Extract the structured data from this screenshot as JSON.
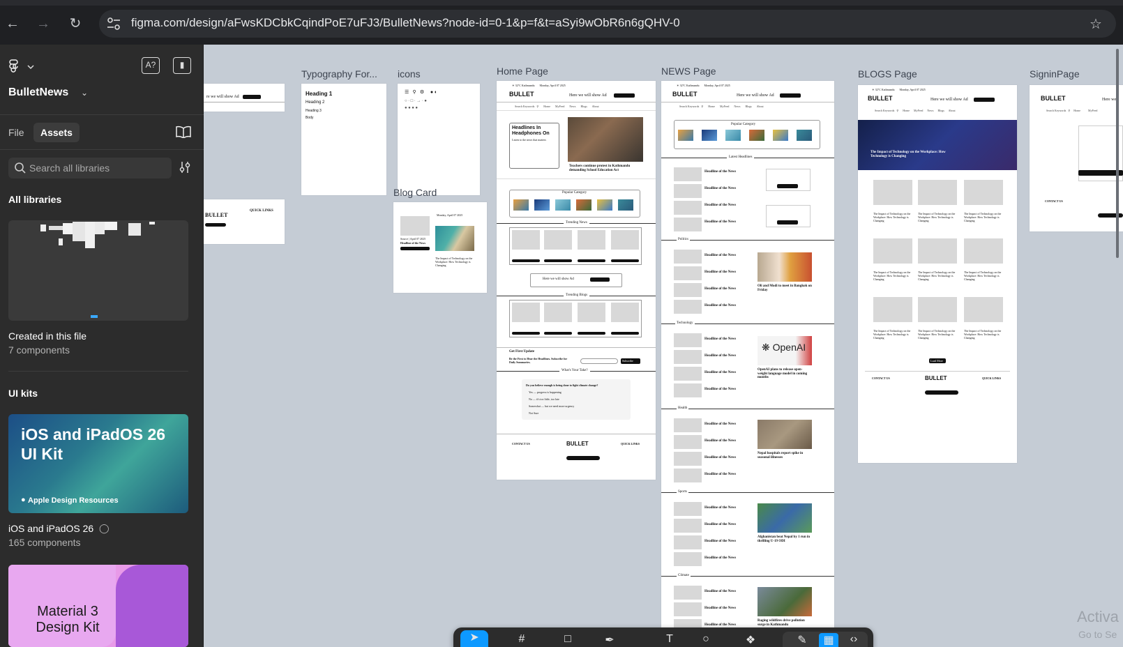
{
  "browser": {
    "url": "figma.com/design/aFwsKDCbkCqindPoE7uFJ3/BulletNews?node-id=0-1&p=f&t=aSyi9wObR6n6gQHV-0"
  },
  "panel": {
    "file_name": "BulletNews",
    "tab_file": "File",
    "tab_assets": "Assets",
    "search_placeholder": "Search all libraries",
    "all_libraries": "All libraries",
    "created_title": "Created in this file",
    "created_count": "7 components",
    "ui_kits": "UI kits",
    "ios_thumb": "iOS and iPadOS 26 UI Kit",
    "ios_badge": "Apple Design Resources",
    "ios_title": "iOS and iPadOS 26",
    "ios_count": "165 components",
    "material_thumb": "Material 3 Design Kit"
  },
  "frames": {
    "typography": "Typography For...",
    "icons": "icons",
    "blog_card": "Blog Card",
    "home": "Home Page",
    "news": "NEWS Page",
    "blogs": "BLOGS Page",
    "signin": "SigninPage"
  },
  "home": {
    "ad_text": "Here we will show Ad",
    "hero_title": "Headlines In Headphones On",
    "hero_sub": "Listen to the news that matters",
    "hero_caption": "Teachers continue protest in Kathmandu demanding School Education Act",
    "popular": "Popular Category",
    "trending_news": "Trending News",
    "trending_blogs": "Trending Blogs",
    "get_update": "Get First Update",
    "update_text": "Be the First to Hear the Headlines. Subscribe for Daily Summaries.",
    "subscribe": "Subscribe",
    "whats_take": "What's Your Take?",
    "poll_q": "Do you believe enough is being done to fight climate change?",
    "poll_opts": [
      "Yes — progress is happening",
      "No — it's too little, too late",
      "Somewhat — but we need more urgency",
      "Not Sure"
    ],
    "contact": "CONTACT US",
    "quick_links": "QUICK LINKS"
  },
  "news": {
    "popular": "Popular Category",
    "latest": "Latest Headlines",
    "sections": [
      "Politics",
      "Technology",
      "Health",
      "Sports",
      "Climate"
    ],
    "headline": "Headline of the News",
    "captions": [
      "Oli and Modi to meet in Bangkok on Friday",
      "OpenAI plans to release open-weight language model in coming months",
      "Nepal hospitals report spike in seasonal illnesses",
      "Afghanistan beat Nepal by 1 run in thrilling U-19 ODI",
      "Raging wildfires drive pollution surge in Kathmandu"
    ]
  },
  "blogs": {
    "hero": "The Impact of Technology on the Workplace: How Technology is Changing",
    "load_more": "Load More"
  },
  "typography": {
    "h1": "Heading 1",
    "h2": "Heading 2",
    "h3": "Heading 3",
    "body": "Body"
  },
  "toolbar": {},
  "overlay": {
    "activate": "Activa",
    "goto": "Go to Se"
  }
}
